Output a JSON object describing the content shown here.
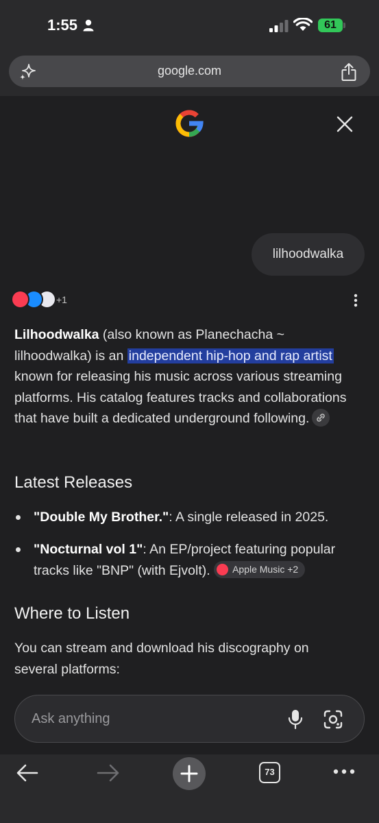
{
  "status_bar": {
    "time": "1:55",
    "battery": "61"
  },
  "browser": {
    "url": "google.com"
  },
  "conversation": {
    "user_query": "lilhoodwalka",
    "source_count": "+1"
  },
  "answer": {
    "intro_bold": "Lilhoodwalka",
    "intro_text_1": " (also known as Planechacha ~ lilhoodwalka) is an ",
    "intro_highlight": "independent hip-hop and rap artist",
    "intro_text_2": " known for releasing his music across various streaming platforms. His catalog features tracks and collaborations that have built a dedicated underground following.",
    "latest_heading": "Latest Releases",
    "release_1_title": "\"Double My Brother.\"",
    "release_1_text": ": A single released in 2025.",
    "release_2_title": "\"Nocturnal vol 1\"",
    "release_2_text": ": An EP/project featuring popular tracks like \"BNP\" (with Ejvolt).",
    "release_2_chip": "Apple Music +2",
    "listen_heading": "Where to Listen",
    "listen_text": "You can stream and download his discography on several platforms:"
  },
  "input": {
    "placeholder": "Ask anything"
  },
  "toolbar": {
    "tab_count": "73"
  },
  "colors": {
    "background": "#1f1f21",
    "highlight": "#233e9e",
    "battery": "#32c759"
  }
}
